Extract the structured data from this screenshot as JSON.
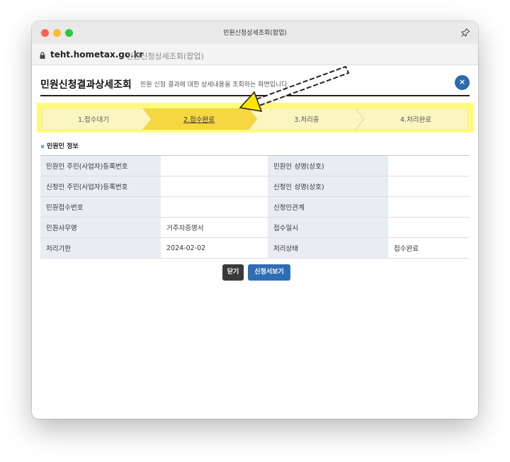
{
  "window": {
    "title": "민원신청상세조회(팝업)"
  },
  "urlbar": {
    "host": "teht.hometax.go.kr",
    "page_title": "민원신청상세조회(팝업)"
  },
  "header": {
    "title": "민원신청결과상세조회",
    "subtitle": "민원 신청 결과에 대한 상세내용을 조회하는 화면입니다.",
    "close_label": "×"
  },
  "steps": [
    {
      "label": "1.접수대기",
      "active": false
    },
    {
      "label": "2.접수완료",
      "active": true
    },
    {
      "label": "3.처리중",
      "active": false
    },
    {
      "label": "4.처리완료",
      "active": false
    }
  ],
  "section": {
    "bullet": "▪",
    "title": "민원인 정보"
  },
  "table": {
    "r1": {
      "h1": "민원인 주민(사업자)등록번호",
      "v1": "",
      "h2": "민원인 성명(상호)",
      "v2": ""
    },
    "r2": {
      "h1": "신청인 주민(사업자)등록번호",
      "v1": "",
      "h2": "신청인 성명(상호)",
      "v2": ""
    },
    "r3": {
      "h1": "민원접수번호",
      "v1": "",
      "h2": "신청인관계",
      "v2": ""
    },
    "r4": {
      "h1": "민원사무명",
      "v1": "거주자증명서",
      "h2": "접수일시",
      "v2": ""
    },
    "r5": {
      "h1": "처리기한",
      "v1": "2024-02-02",
      "h2": "처리상태",
      "v2": "접수완료"
    }
  },
  "buttons": {
    "close": "닫기",
    "view": "신청서보기"
  },
  "colors": {
    "highlight": "#fffb7a",
    "active_step": "#f6d742",
    "step_bg": "#fbf6c0",
    "button_blue": "#2e6db4",
    "button_dark": "#3a3a3a",
    "header_cell": "#e8ecf3"
  }
}
